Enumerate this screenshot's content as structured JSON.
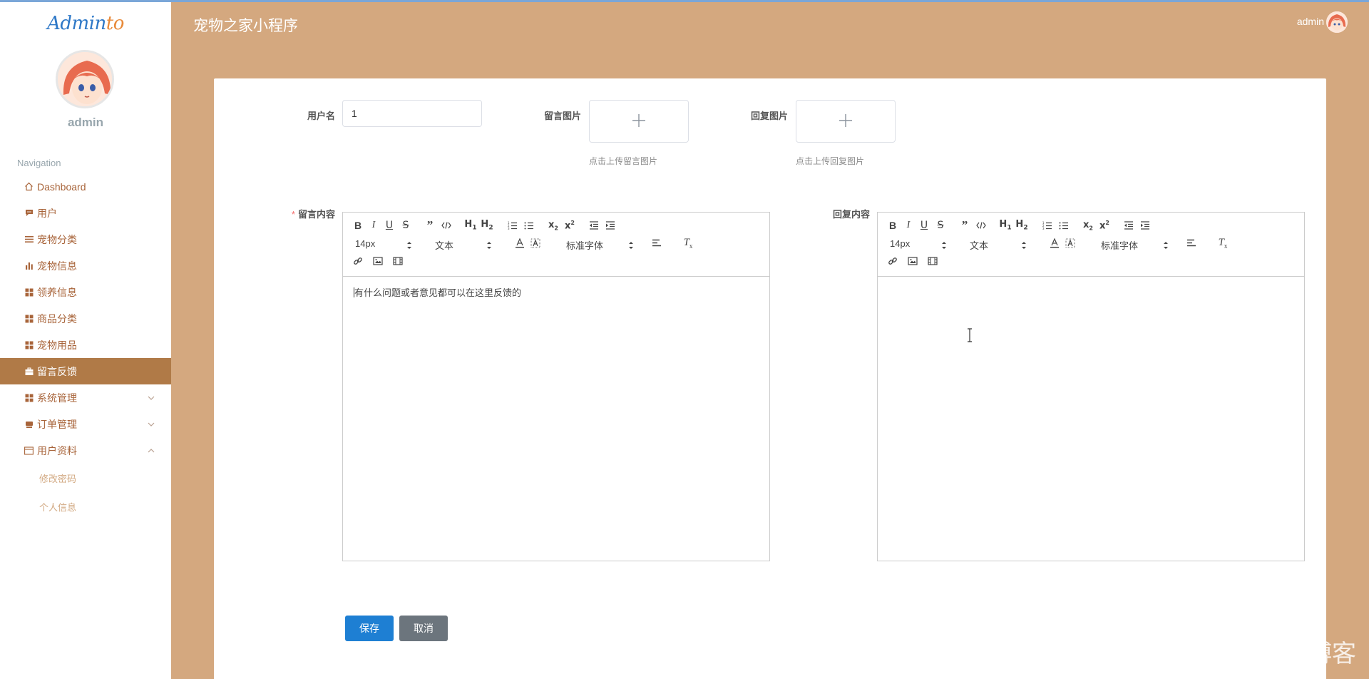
{
  "app": {
    "logo_prefix": "Admin",
    "logo_suffix": "to",
    "title": "宠物之家小程序"
  },
  "header": {
    "username": "admin"
  },
  "sidebar": {
    "username": "admin",
    "nav_heading": "Navigation",
    "items": [
      {
        "label": "Dashboard",
        "icon": "home-icon"
      },
      {
        "label": "用户",
        "icon": "chat-icon"
      },
      {
        "label": "宠物分类",
        "icon": "list-icon"
      },
      {
        "label": "宠物信息",
        "icon": "bar-chart-icon"
      },
      {
        "label": "领养信息",
        "icon": "grid-icon"
      },
      {
        "label": "商品分类",
        "icon": "grid-icon"
      },
      {
        "label": "宠物用品",
        "icon": "grid-icon"
      },
      {
        "label": "留言反馈",
        "icon": "briefcase-icon",
        "active": true
      },
      {
        "label": "系统管理",
        "icon": "grid-icon",
        "expand": "chevron-down-icon"
      },
      {
        "label": "订单管理",
        "icon": "cart-icon",
        "expand": "chevron-down-icon"
      },
      {
        "label": "用户资料",
        "icon": "card-icon",
        "expand": "chevron-up-icon"
      }
    ],
    "subitems": [
      {
        "label": "修改密码"
      },
      {
        "label": "个人信息"
      }
    ]
  },
  "form": {
    "username_label": "用户名",
    "username_value": "1",
    "message_image_label": "留言图片",
    "message_image_tip": "点击上传留言图片",
    "reply_image_label": "回复图片",
    "reply_image_tip": "点击上传回复图片",
    "content_label": "留言内容",
    "content_required": "*",
    "content_value": "有什么问题或者意见都可以在这里反馈的",
    "reply_label": "回复内容",
    "reply_value": "",
    "save_label": "保存",
    "cancel_label": "取消"
  },
  "editor_toolbar": {
    "font_size": "14px",
    "header": "文本",
    "font_family": "标准字体",
    "buttons": [
      "bold-icon",
      "italic-icon",
      "underline-icon",
      "strike-icon",
      "blockquote-icon",
      "code-block-icon",
      "h1-icon",
      "h2-icon",
      "ordered-list-icon",
      "bullet-list-icon",
      "subscript-icon",
      "superscript-icon",
      "outdent-icon",
      "indent-icon",
      "text-color-icon",
      "background-color-icon",
      "align-icon",
      "clean-icon",
      "link-icon",
      "image-icon",
      "video-icon"
    ]
  },
  "watermark": "CSDN @alan的博客",
  "colors": {
    "header_bg": "#d4a87f",
    "active_nav": "#b07a47",
    "nav_text": "#a8643a",
    "primary": "#1e7fd3",
    "cancel": "#6c757d"
  }
}
